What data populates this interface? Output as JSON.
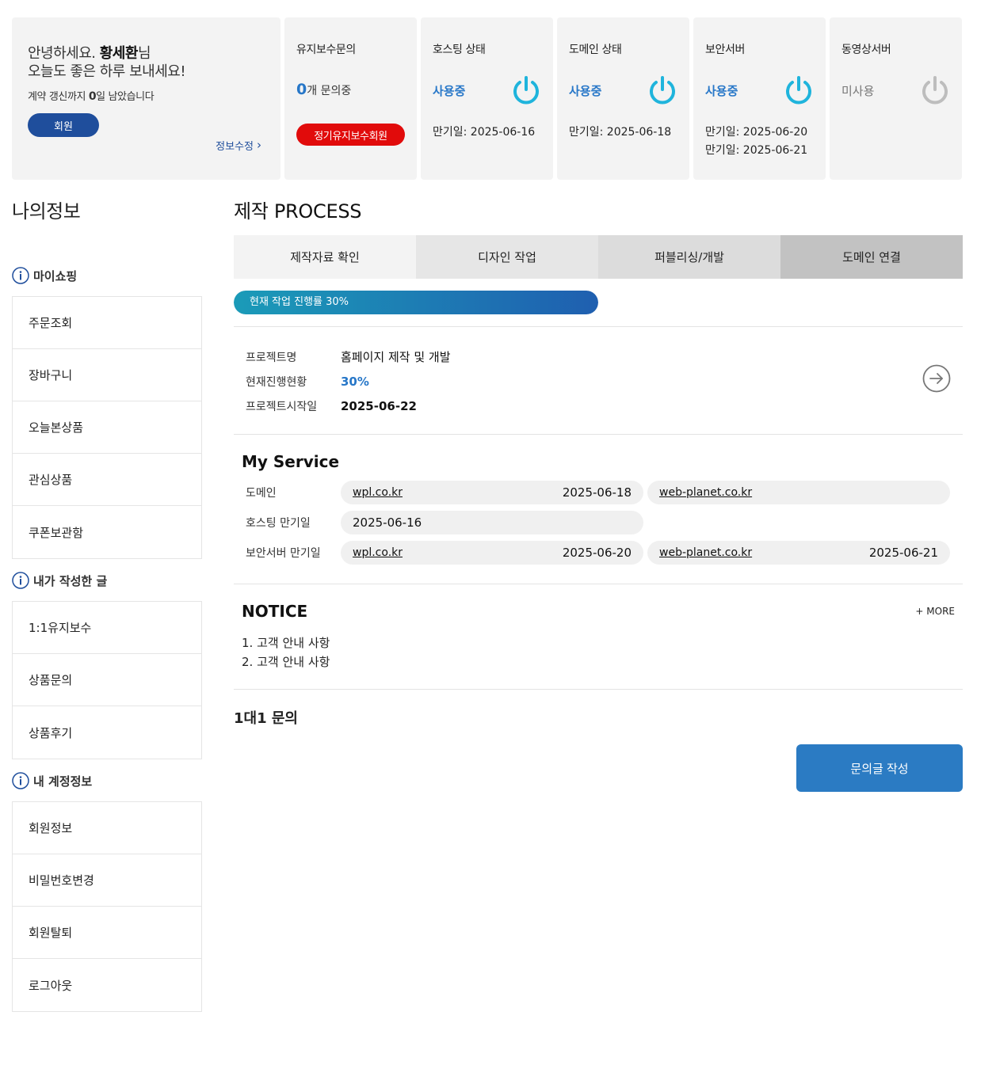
{
  "welcome": {
    "greeting_prefix": "안녕하세요. ",
    "user_name": "황세환",
    "greeting_suffix": "님",
    "greeting_line2": "오늘도 좋은 하루 보내세요!",
    "contract_prefix": "계약 갱신까지 ",
    "contract_days": "0",
    "contract_suffix": "일 남았습니다",
    "member_badge": "회원",
    "edit_link": "정보수정"
  },
  "cards": {
    "maintenance": {
      "title": "유지보수문의",
      "count": "0",
      "count_suffix": "개 문의중",
      "badge": "정기유지보수회원"
    },
    "hosting": {
      "title": "호스팅 상태",
      "status": "사용중",
      "expiry": [
        "만기일: 2025-06-16"
      ]
    },
    "domain": {
      "title": "도메인 상태",
      "status": "사용중",
      "expiry": [
        "만기일: 2025-06-18"
      ]
    },
    "security": {
      "title": "보안서버",
      "status": "사용중",
      "expiry": [
        "만기일: 2025-06-20",
        "만기일: 2025-06-21"
      ]
    },
    "video": {
      "title": "동영상서버",
      "status": "미사용"
    }
  },
  "colors": {
    "accent_blue": "#2777c8",
    "badge_navy": "#1f4e9c",
    "badge_red": "#e10b0b",
    "power_on": "#1fb4dc",
    "power_off": "#bdbdbd",
    "button_blue": "#2b7bc3"
  },
  "sidebar": {
    "title": "나의정보",
    "sections": [
      {
        "title": "마이쇼핑",
        "icon": "info-icon",
        "items": [
          "주문조회",
          "장바구니",
          "오늘본상품",
          "관심상품",
          "쿠폰보관함"
        ]
      },
      {
        "title": "내가 작성한 글",
        "icon": "info-icon",
        "items": [
          "1:1유지보수",
          "상품문의",
          "상품후기"
        ]
      },
      {
        "title": "내 계정정보",
        "icon": "info-icon",
        "items": [
          "회원정보",
          "비밀번호변경",
          "회원탈퇴",
          "로그아웃"
        ]
      }
    ]
  },
  "process": {
    "title": "제작 PROCESS",
    "steps": [
      {
        "label": "제작자료 확인",
        "bg": "#f3f3f3"
      },
      {
        "label": "디자인 작업",
        "bg": "#e6e6e6"
      },
      {
        "label": "퍼블리싱/개발",
        "bg": "#dcdcdc"
      },
      {
        "label": "도메인 연결",
        "bg": "#c2c2c2"
      }
    ],
    "progress_label": "현재 작업 진행률 30%",
    "progress_percent": 30
  },
  "project": {
    "rows": [
      {
        "label": "프로젝트명",
        "value": "홈페이지 제작 및 개발",
        "style": ""
      },
      {
        "label": "현재진행현황",
        "value": "30%",
        "style": "blue"
      },
      {
        "label": "프로젝트시작일",
        "value": "2025-06-22",
        "style": "bold"
      }
    ],
    "arrow_icon": "arrow-right-circle-icon"
  },
  "service": {
    "title": "My Service",
    "rows": [
      {
        "label": "도메인",
        "pills": [
          {
            "link": "wpl.co.kr",
            "date": "2025-06-18"
          },
          {
            "link": "web-planet.co.kr",
            "date": ""
          }
        ]
      },
      {
        "label": "호스팅 만기일",
        "pills": [
          {
            "link": "",
            "date": "2025-06-16"
          }
        ]
      },
      {
        "label": "보안서버 만기일",
        "pills": [
          {
            "link": "wpl.co.kr",
            "date": "2025-06-20"
          },
          {
            "link": "web-planet.co.kr",
            "date": "2025-06-21"
          }
        ]
      }
    ]
  },
  "notice": {
    "title": "NOTICE",
    "more": "+ MORE",
    "items": [
      "1. 고객 안내 사항",
      "2. 고객 안내 사항"
    ]
  },
  "qna": {
    "title": "1대1 문의",
    "write_button": "문의글 작성"
  }
}
